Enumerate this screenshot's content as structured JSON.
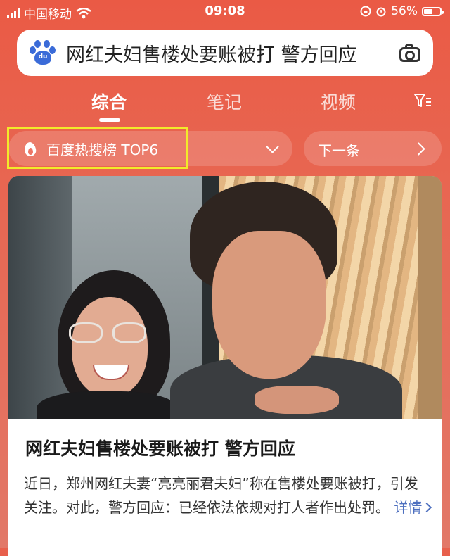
{
  "status_bar": {
    "carrier": "中国移动",
    "time": "09:08",
    "battery": "56%"
  },
  "search": {
    "query": "网红夫妇售楼处要账被打 警方回应",
    "logo_text": "du"
  },
  "tabs": [
    {
      "label": "综合",
      "active": true
    },
    {
      "label": "笔记",
      "active": false
    },
    {
      "label": "视频",
      "active": false
    }
  ],
  "hot": {
    "label": "百度热搜榜 TOP6",
    "next_label": "下一条"
  },
  "article": {
    "title": "网红夫妇售楼处要账被打 警方回应",
    "summary": "近日，郑州网红夫妻“亮亮丽君夫妇”称在售楼处要账被打，引发关注。对此，警方回应：已经依法依规对打人者作出处罚。",
    "more_label": "详情"
  },
  "colors": {
    "background": "#e8604c",
    "highlight_box": "#f2ea2a",
    "link": "#4d6fbf"
  }
}
